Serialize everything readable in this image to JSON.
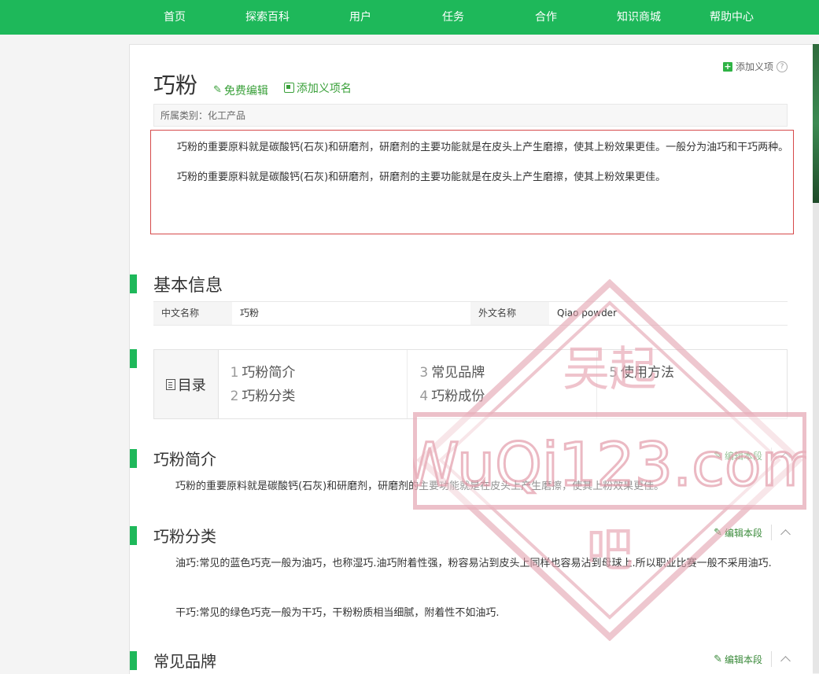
{
  "topnav": {
    "items": [
      "首页",
      "探索百科",
      "用户",
      "任务",
      "合作",
      "知识商城",
      "帮助中心"
    ]
  },
  "header": {
    "title": "巧粉",
    "edit_label": "免费编辑",
    "add_sense_label": "添加义项名",
    "add_term_label": "添加义项"
  },
  "category": "所属类别：化工产品",
  "summary": [
    "巧粉的重要原料就是碳酸钙(石灰)和研磨剂，研磨剂的主要功能就是在皮头上产生磨擦，使其上粉效果更佳。一般分为油巧和干巧两种。",
    "巧粉的重要原料就是碳酸钙(石灰)和研磨剂，研磨剂的主要功能就是在皮头上产生磨擦，使其上粉效果更佳。"
  ],
  "basic": {
    "heading": "基本信息",
    "rows": [
      {
        "label": "中文名称",
        "value": "巧粉"
      },
      {
        "label": "外文名称",
        "value": "Qiao powder"
      }
    ]
  },
  "toc": {
    "heading": "目录",
    "items": [
      {
        "num": "1",
        "label": "巧粉简介"
      },
      {
        "num": "2",
        "label": "巧粉分类"
      },
      {
        "num": "3",
        "label": "常见品牌"
      },
      {
        "num": "4",
        "label": "巧粉成份"
      },
      {
        "num": "5",
        "label": "使用方法"
      }
    ]
  },
  "sections": [
    {
      "heading": "巧粉简介",
      "edit_label": "编辑本段",
      "paras": [
        "巧粉的重要原料就是碳酸钙(石灰)和研磨剂，研磨剂的主要功能就是在皮头上产生磨擦，使其上粉效果更佳。"
      ]
    },
    {
      "heading": "巧粉分类",
      "edit_label": "编辑本段",
      "paras": [
        "油巧:常见的蓝色巧克一般为油巧，也称湿巧.油巧附着性强，粉容易沾到皮头上同样也容易沾到母球上.所以职业比赛一般不采用油巧.",
        "干巧:常见的绿色巧克一般为干巧，干粉粉质相当细腻，附着性不如油巧."
      ]
    },
    {
      "heading": "常见品牌",
      "edit_label": "编辑本段",
      "paras": []
    }
  ],
  "watermark": {
    "name": "吴起",
    "domain": "WuQi123.com",
    "suffix": "吧"
  }
}
